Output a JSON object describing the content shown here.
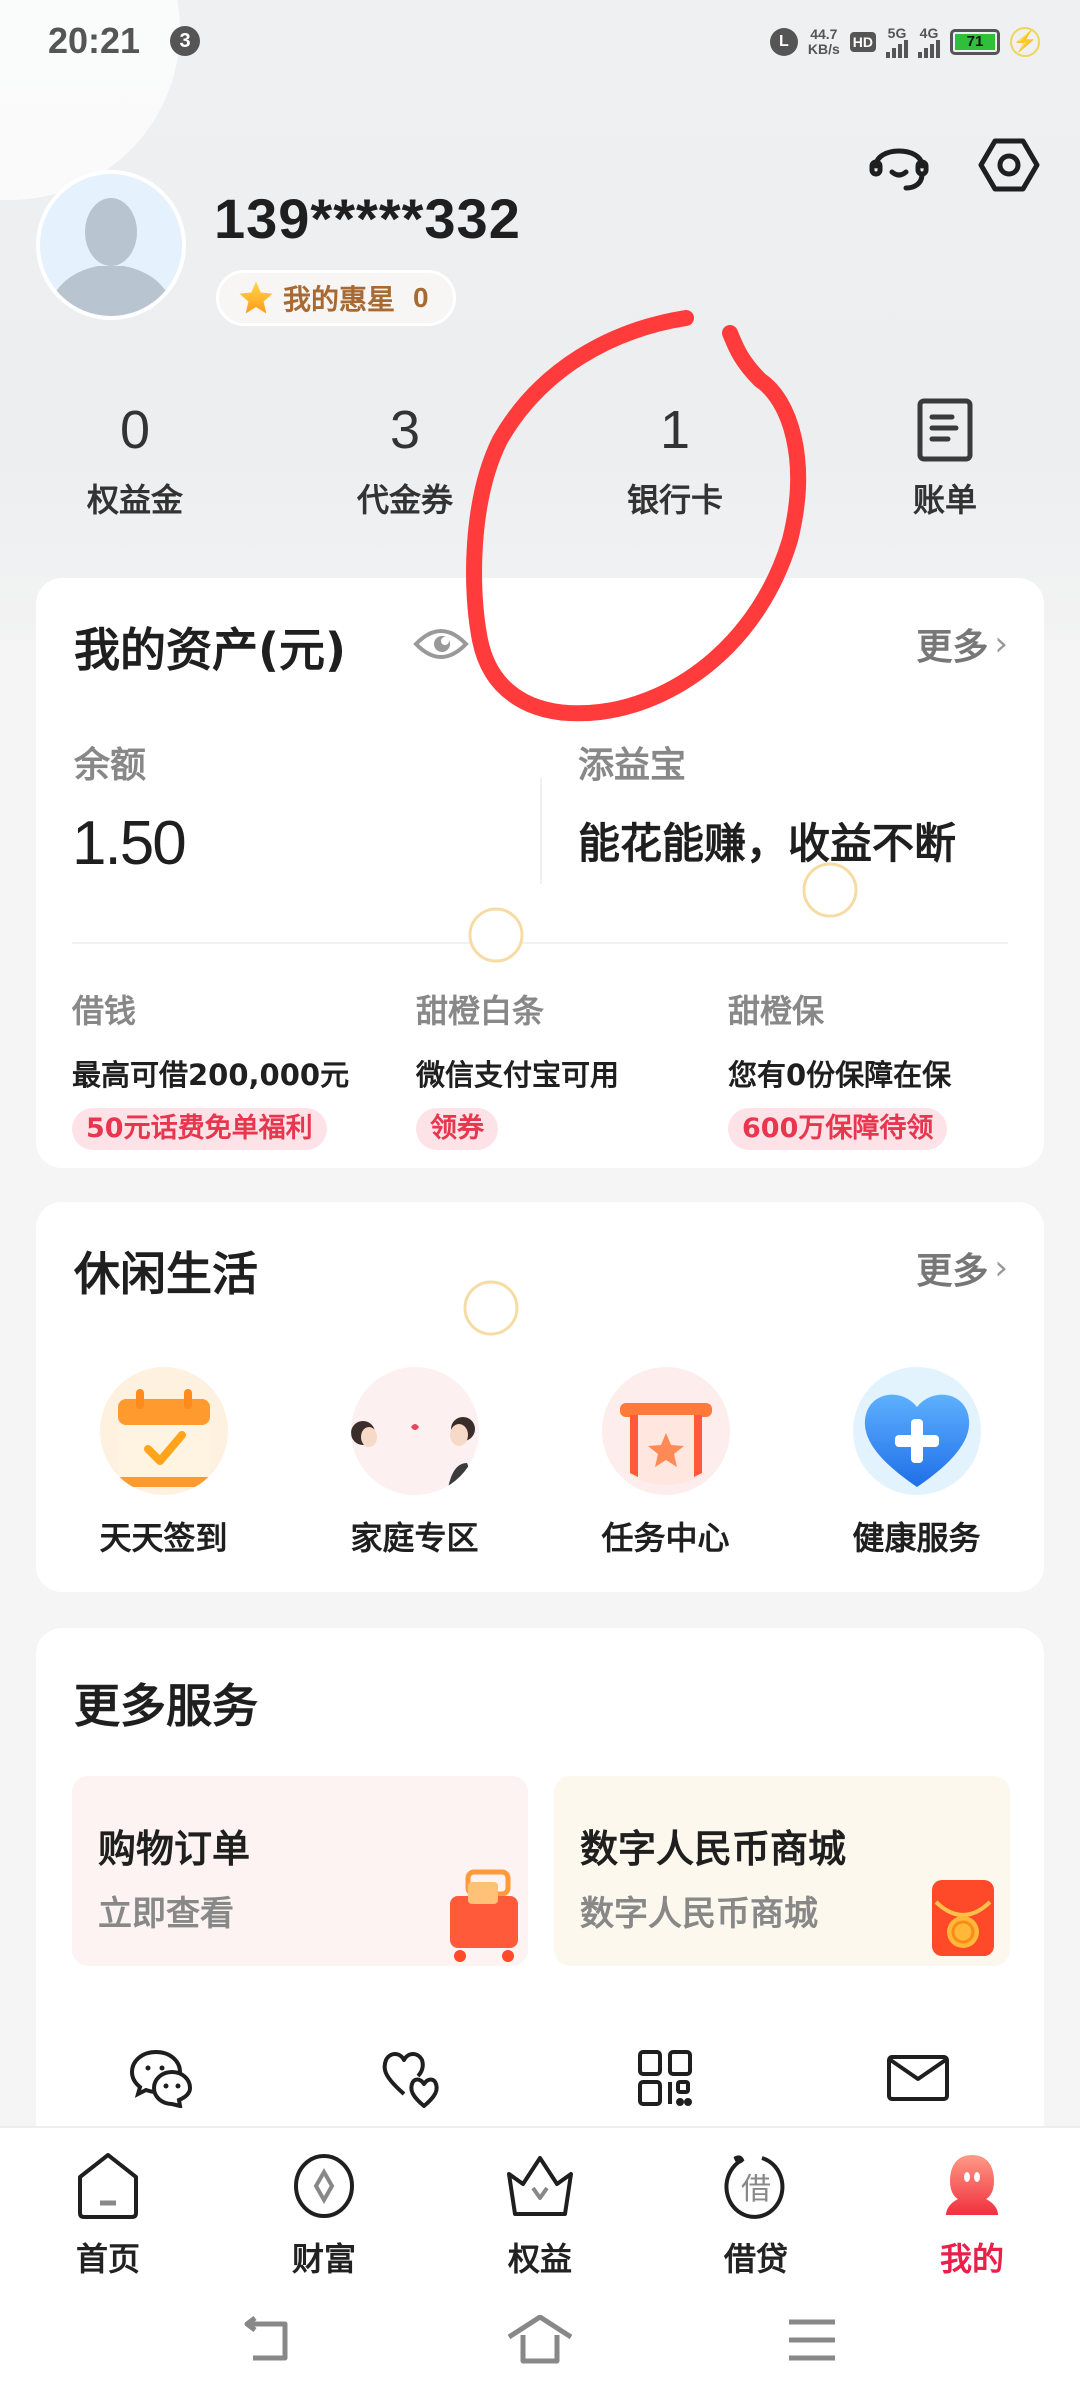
{
  "status_bar": {
    "time": "20:21",
    "notification_count": "3",
    "alarm_glyph": "L",
    "net_speed_value": "44.7",
    "net_speed_unit": "KB/s",
    "hd_label": "HD",
    "sim1_network": "5G",
    "sim2_network": "4G",
    "battery_level": "71",
    "charging_glyph": "⚡"
  },
  "header": {
    "icons": [
      "headset-service-icon",
      "settings-hex-icon"
    ]
  },
  "profile": {
    "phone_masked": "139*****332",
    "star_label": "我的惠星",
    "star_value": "0"
  },
  "stats": [
    {
      "value": "0",
      "label": "权益金"
    },
    {
      "value": "3",
      "label": "代金券"
    },
    {
      "value": "1",
      "label": "银行卡"
    },
    {
      "icon": "bill-icon",
      "label": "账单"
    }
  ],
  "assets": {
    "title": "我的资产(元)",
    "more": "更多",
    "chevron": "›",
    "balance_label": "余额",
    "balance_value": "1.50",
    "tianyibao_label": "添益宝",
    "tianyibao_text": "能花能赚，收益不断",
    "products": [
      {
        "label": "借钱",
        "desc": "最高可借200,000元",
        "tag": "50元话费免单福利"
      },
      {
        "label": "甜橙白条",
        "desc": "微信支付宝可用",
        "tag": "领券"
      },
      {
        "label": "甜橙保",
        "desc": "您有0份保障在保",
        "tag": "600万保障待领"
      }
    ]
  },
  "leisure": {
    "title": "休闲生活",
    "more": "更多",
    "chevron": "›",
    "items": [
      {
        "label": "天天签到",
        "icon": "calendar-check-icon"
      },
      {
        "label": "家庭专区",
        "icon": "family-icon"
      },
      {
        "label": "任务中心",
        "icon": "task-banner-star-icon"
      },
      {
        "label": "健康服务",
        "icon": "health-heart-plus-icon"
      }
    ]
  },
  "more_services": {
    "title": "更多服务",
    "tiles": [
      {
        "title": "购物订单",
        "subtitle": "立即查看",
        "icon": "shopping-cart-icon"
      },
      {
        "title": "数字人民币商城",
        "subtitle": "数字人民币商城",
        "icon": "red-bag-icon"
      }
    ],
    "bottom_icons": [
      "wechat-icon",
      "hearts-icon",
      "qr-code-icon",
      "mail-icon"
    ]
  },
  "tabbar": {
    "items": [
      {
        "label": "首页",
        "icon": "home-icon"
      },
      {
        "label": "财富",
        "icon": "wealth-coin-icon"
      },
      {
        "label": "权益",
        "icon": "crown-icon"
      },
      {
        "label": "借贷",
        "icon": "loan-icon",
        "icon_text": "借"
      },
      {
        "label": "我的",
        "icon": "profile-mascot-icon",
        "active": true
      }
    ],
    "active_color": "#e8204a"
  },
  "colors": {
    "accent_red": "#e8204a",
    "tag_bg": "#fde3e8",
    "tag_text": "#e8364f",
    "star_text": "#a86a32",
    "annotation_red": "#ff3b3b"
  }
}
